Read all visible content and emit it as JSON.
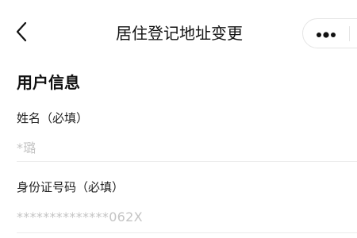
{
  "header": {
    "title": "居住登记地址变更",
    "back_icon": "chevron-left-icon",
    "more_icon": "more-dots-icon"
  },
  "section": {
    "title": "用户信息"
  },
  "fields": [
    {
      "label": "姓名（必填）",
      "value": "*璐"
    },
    {
      "label": "身份证号码（必填）",
      "value": "**************062X"
    }
  ]
}
